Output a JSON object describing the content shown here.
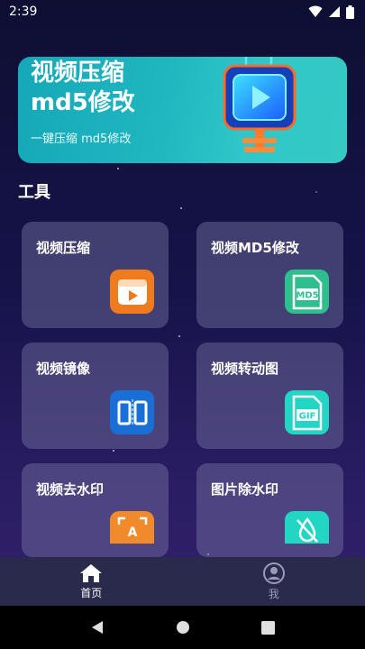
{
  "status": {
    "time": "2:39"
  },
  "banner": {
    "title": "视频压缩\nmd5修改",
    "subtitle": "一键压缩 md5修改"
  },
  "section": {
    "title": "工具"
  },
  "tools": [
    {
      "label": "视频压缩",
      "icon": "video-compress-icon",
      "color": "#f07a1e"
    },
    {
      "label": "视频MD5修改",
      "icon": "md5-file-icon",
      "color": "#2fbf8f",
      "icon_text": "MD5"
    },
    {
      "label": "视频镜像",
      "icon": "mirror-icon",
      "color": "#1a6fd6"
    },
    {
      "label": "视频转动图",
      "icon": "gif-file-icon",
      "color": "#22d6c4",
      "icon_text": "GIF"
    },
    {
      "label": "视频去水印",
      "icon": "remove-watermark-icon",
      "color": "#f08a2a",
      "icon_text": "A"
    },
    {
      "label": "图片除水印",
      "icon": "image-watermark-icon",
      "color": "#22d6c4"
    }
  ],
  "nav": {
    "home_label": "首页",
    "me_label": "我"
  }
}
